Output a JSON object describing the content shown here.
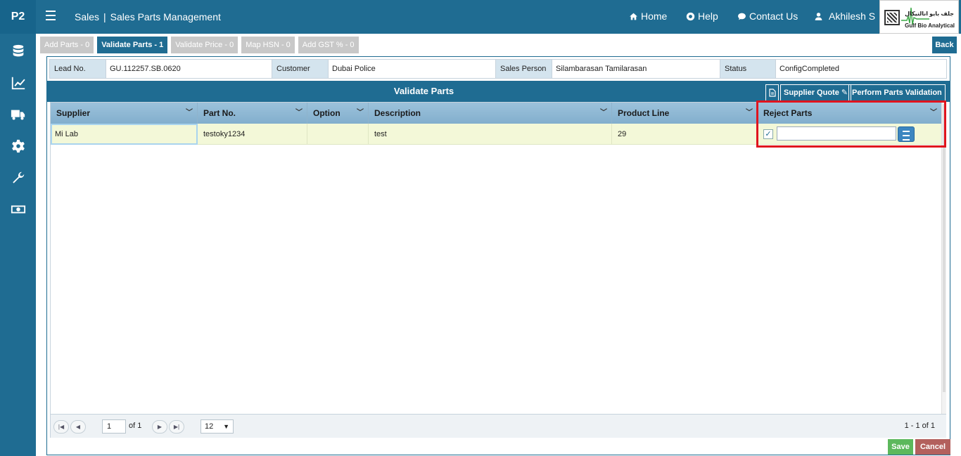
{
  "app": {
    "brand": "P2"
  },
  "header": {
    "module": "Sales",
    "page": "Sales Parts Management",
    "nav": {
      "home": "Home",
      "help": "Help",
      "contact": "Contact Us",
      "user": "Akhilesh S"
    },
    "logo": {
      "arabic": "جلف بايو انالتيكال",
      "english": "Gulf Bio Analytical"
    }
  },
  "sidebar": {
    "icons": [
      "database-icon",
      "chart-line-icon",
      "truck-icon",
      "gear-icon",
      "wrench-icon",
      "money-icon"
    ]
  },
  "steps": [
    {
      "label": "Add Parts - 0",
      "active": false
    },
    {
      "label": "Validate Parts - 1",
      "active": true
    },
    {
      "label": "Validate Price - 0",
      "active": false
    },
    {
      "label": "Map HSN - 0",
      "active": false
    },
    {
      "label": "Add GST % - 0",
      "active": false
    }
  ],
  "back_label": "Back",
  "info": {
    "lead_label": "Lead No.",
    "lead_value": "GU.112257.SB.0620",
    "customer_label": "Customer",
    "customer_value": "Dubai Police",
    "salesperson_label": "Sales Person",
    "salesperson_value": "Silambarasan Tamilarasan",
    "status_label": "Status",
    "status_value": "ConfigCompleted"
  },
  "panel": {
    "title": "Validate Parts",
    "supplier_quote": "Supplier Quote",
    "perform_validation": "Perform Parts Validation"
  },
  "grid": {
    "columns": [
      "Supplier",
      "Part No.",
      "Option",
      "Description",
      "Product Line",
      "Reject Parts"
    ],
    "rows": [
      {
        "supplier": "Mi Lab",
        "part_no": "testoky1234",
        "option": "",
        "description": "test",
        "product_line": "29",
        "reject": true,
        "reject_reason": ""
      }
    ]
  },
  "pager": {
    "page": "1",
    "of": "of 1",
    "page_size": "12",
    "range": "1 - 1 of 1"
  },
  "actions": {
    "save": "Save",
    "cancel": "Cancel"
  },
  "colors": {
    "primary": "#1f6c92",
    "highlight": "#e0141e",
    "row": "#f3f8d8",
    "save": "#5cb85c",
    "cancel": "#b3605d"
  }
}
